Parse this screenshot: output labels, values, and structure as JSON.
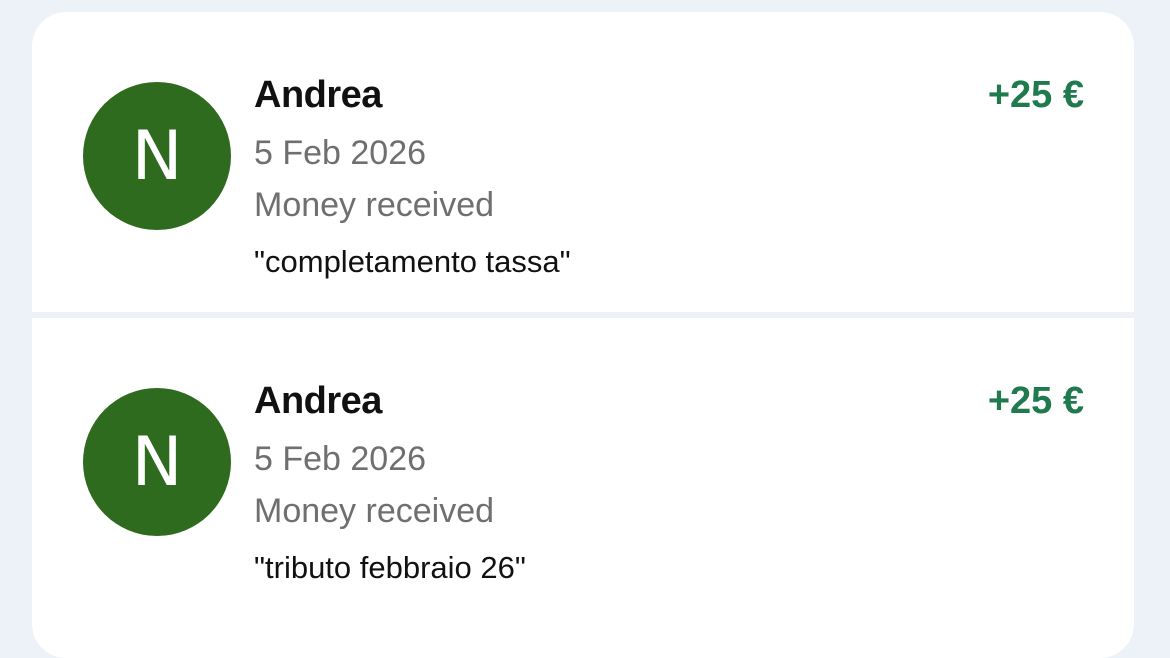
{
  "transactions": [
    {
      "avatar_letter": "N",
      "name": "Andrea",
      "date": "5 Feb 2026",
      "type": "Money received",
      "note": "\"completamento tassa\"",
      "amount": "+25 €"
    },
    {
      "avatar_letter": "N",
      "name": "Andrea",
      "date": "5 Feb 2026",
      "type": "Money received",
      "note": "\"tributo febbraio 26\"",
      "amount": "+25 €"
    }
  ],
  "colors": {
    "background": "#edf1f8",
    "card": "#ffffff",
    "avatar": "#2f6b1e",
    "amount": "#1f7a4e",
    "secondary_text": "#6f6f6f"
  }
}
